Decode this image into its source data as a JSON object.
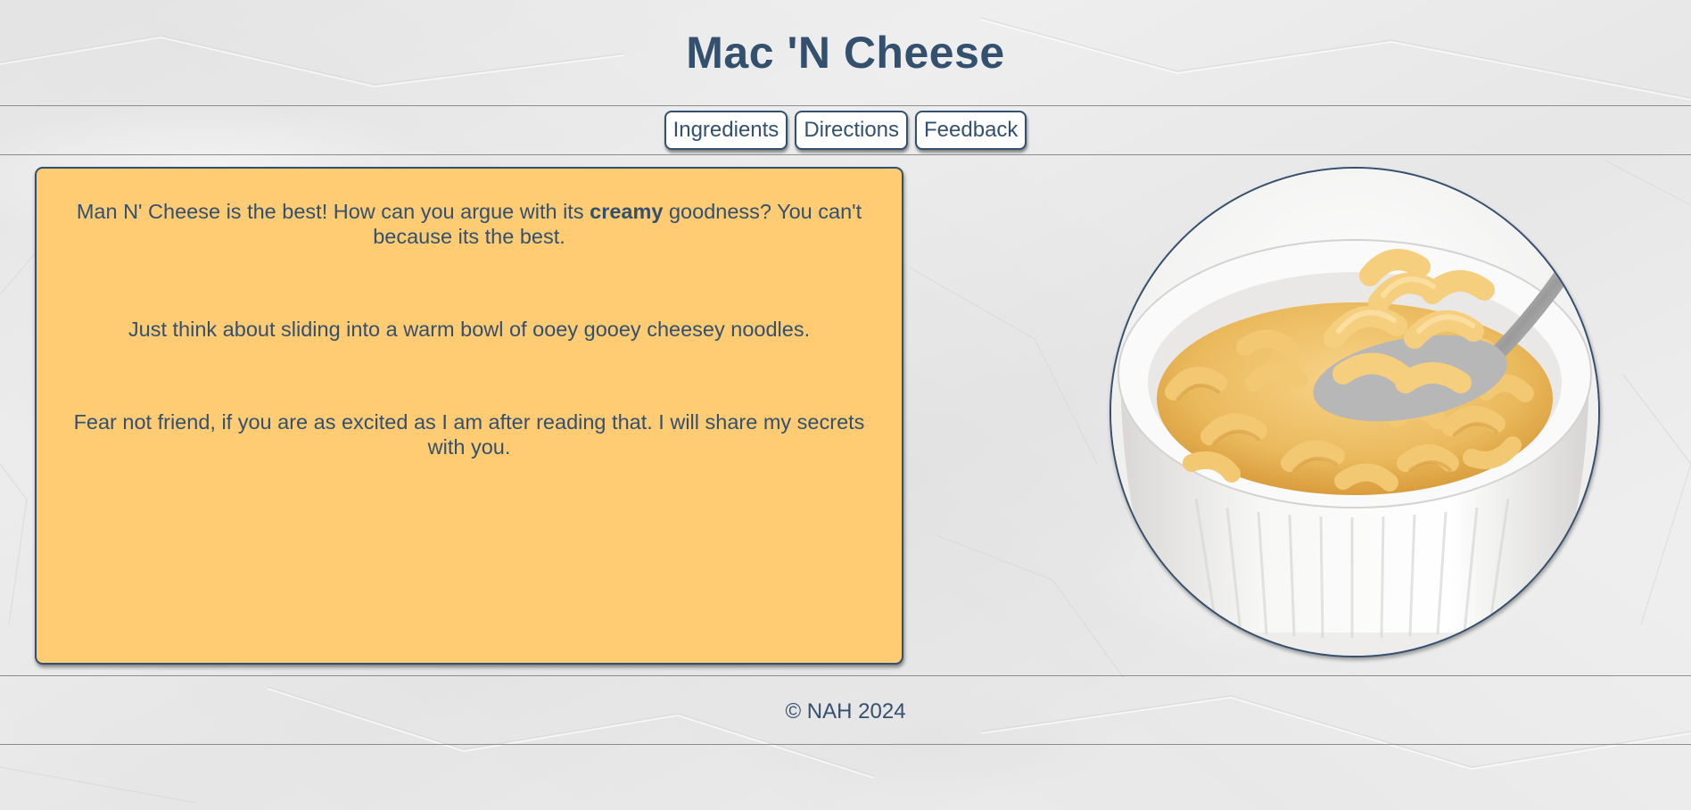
{
  "header": {
    "title": "Mac 'N Cheese"
  },
  "nav": {
    "items": [
      {
        "label": "Ingredients"
      },
      {
        "label": "Directions"
      },
      {
        "label": "Feedback"
      }
    ]
  },
  "intro": {
    "p1_before": "Man N' Cheese is the best! How can you argue with its ",
    "p1_bold": "creamy",
    "p1_after": " goodness? You can't because its the best.",
    "p2": "Just think about sliding into a warm bowl of ooey gooey cheesey noodles.",
    "p3": "Fear not friend, if you are as excited as I am after reading that. I will share my secrets with you."
  },
  "footer": {
    "copyright": "© NAH 2024"
  },
  "colors": {
    "text": "#34506f",
    "card_background": "#ffcb73",
    "page_background": "#eeeeee",
    "button_background": "#ffffff"
  }
}
